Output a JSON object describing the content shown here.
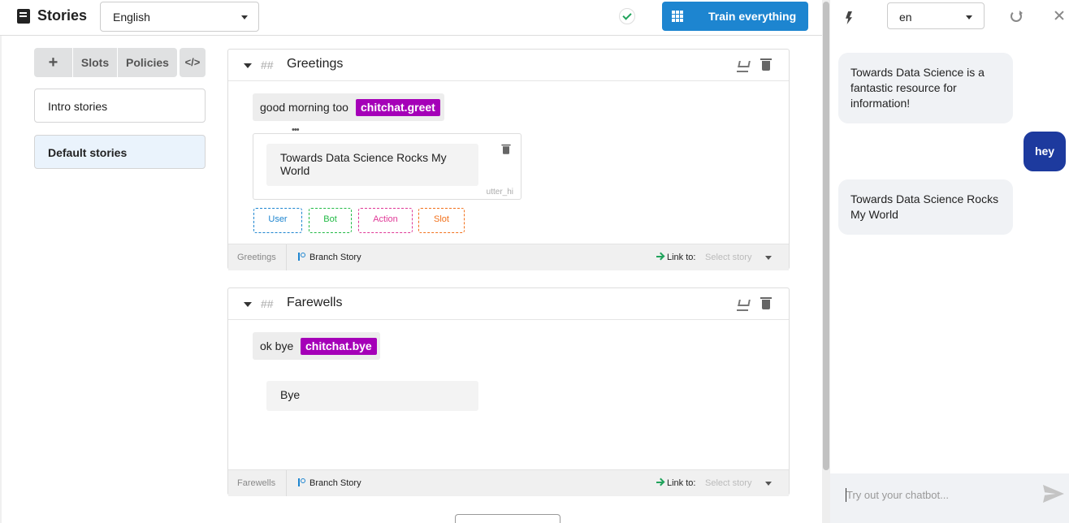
{
  "header": {
    "title": "Stories",
    "language": "English",
    "train_label": "Train everything",
    "icons": [
      "book-icon",
      "check-icon",
      "grid-icon"
    ]
  },
  "sidebar": {
    "toolbar": {
      "add": "+",
      "slots": "Slots",
      "policies": "Policies",
      "code": "</>"
    },
    "groups": [
      "Intro stories",
      "Default stories"
    ],
    "active_group": "Default stories"
  },
  "stories": [
    {
      "hashes": "##",
      "title": "Greetings",
      "user_utterance": "good morning too",
      "intent": "chitchat.greet",
      "ellipsis": "•••",
      "bot_response": "Towards Data Science Rocks My World",
      "response_name": "utter_hi",
      "add_buttons": [
        "User",
        "Bot",
        "Action",
        "Slot"
      ],
      "footer": {
        "name": "Greetings",
        "branch": "Branch Story",
        "link_to": "Link to:",
        "select_placeholder": "Select story"
      }
    },
    {
      "hashes": "##",
      "title": "Farewells",
      "user_utterance": "ok bye",
      "intent": "chitchat.bye",
      "bot_response": "Bye",
      "footer": {
        "name": "Farewells",
        "branch": "Branch Story",
        "link_to": "Link to:",
        "select_placeholder": "Select story"
      }
    }
  ],
  "chat": {
    "language": "en",
    "messages": [
      {
        "from": "bot",
        "text": "Towards Data Science is a fantastic resource for information!"
      },
      {
        "from": "user",
        "text": "hey"
      },
      {
        "from": "bot",
        "text": "Towards Data Science Rocks My World"
      }
    ],
    "input_placeholder": "Try out your chatbot..."
  },
  "colors": {
    "accent": "#1d85d0",
    "intent": "#a500b8",
    "user_bubble": "#1d3a9e",
    "user_btn": "#1d85d0",
    "bot_btn": "#21ba45",
    "action_btn": "#e03997",
    "slot_btn": "#f2711c"
  }
}
